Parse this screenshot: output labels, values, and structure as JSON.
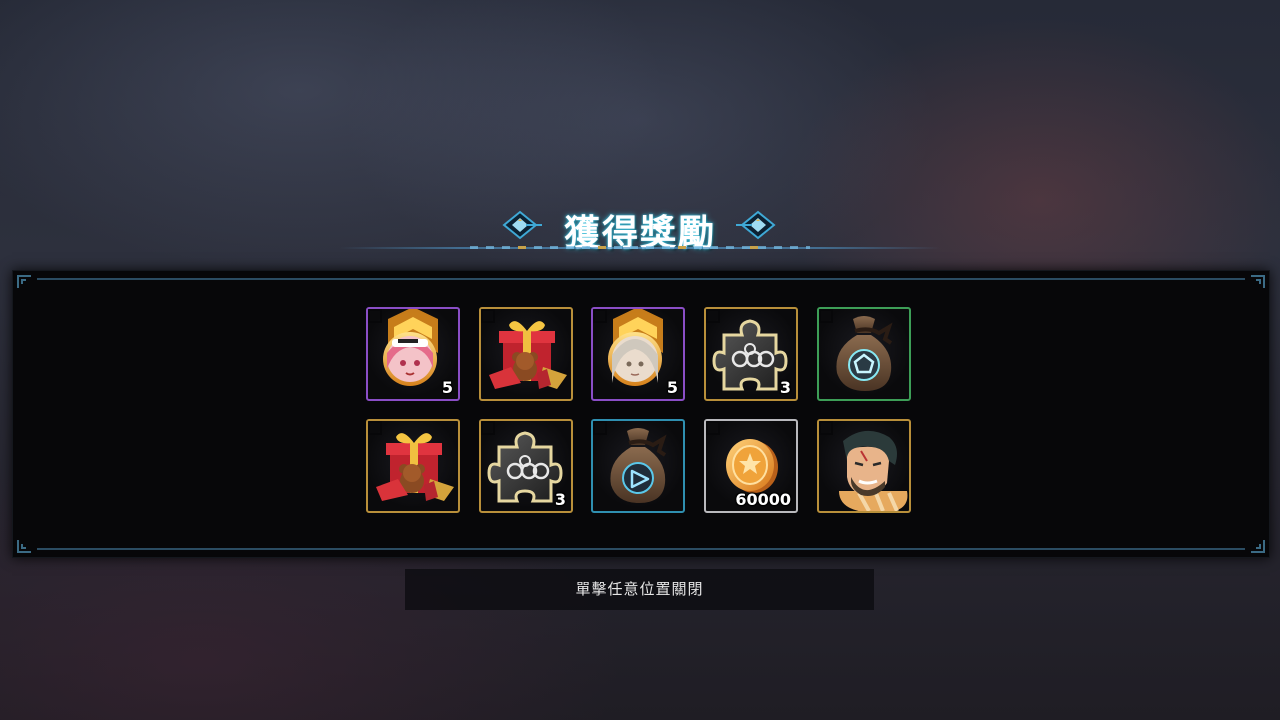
{
  "title": "獲得獎勵",
  "colors": {
    "title_glow": "#3cc8e6",
    "rarity_purple": "#8a4ec6",
    "rarity_gold": "#b88f3a",
    "rarity_green": "#3d9e57",
    "rarity_blue": "#2f8fb0",
    "rarity_white": "#b9b9bd"
  },
  "rewards": [
    {
      "icon": "character-promotion-icon-pink-hair",
      "rarity": "purple",
      "quantity": "5"
    },
    {
      "icon": "gift-box-teddy-icon",
      "rarity": "gold",
      "quantity": ""
    },
    {
      "icon": "character-promotion-icon-silver-hair",
      "rarity": "purple",
      "quantity": "5"
    },
    {
      "icon": "puzzle-piece-icon",
      "rarity": "gold",
      "quantity": "3"
    },
    {
      "icon": "loot-bag-pentagon-icon",
      "rarity": "green",
      "quantity": ""
    },
    {
      "icon": "gift-box-teddy-icon",
      "rarity": "gold",
      "quantity": ""
    },
    {
      "icon": "puzzle-piece-icon",
      "rarity": "gold",
      "quantity": "3"
    },
    {
      "icon": "loot-bag-triangle-icon",
      "rarity": "blue",
      "quantity": ""
    },
    {
      "icon": "gold-coin-icon",
      "rarity": "white",
      "quantity": "60000"
    },
    {
      "icon": "character-portrait-icon-scarred-man",
      "rarity": "gold",
      "quantity": ""
    }
  ],
  "close_hint": "單擊任意位置關閉"
}
